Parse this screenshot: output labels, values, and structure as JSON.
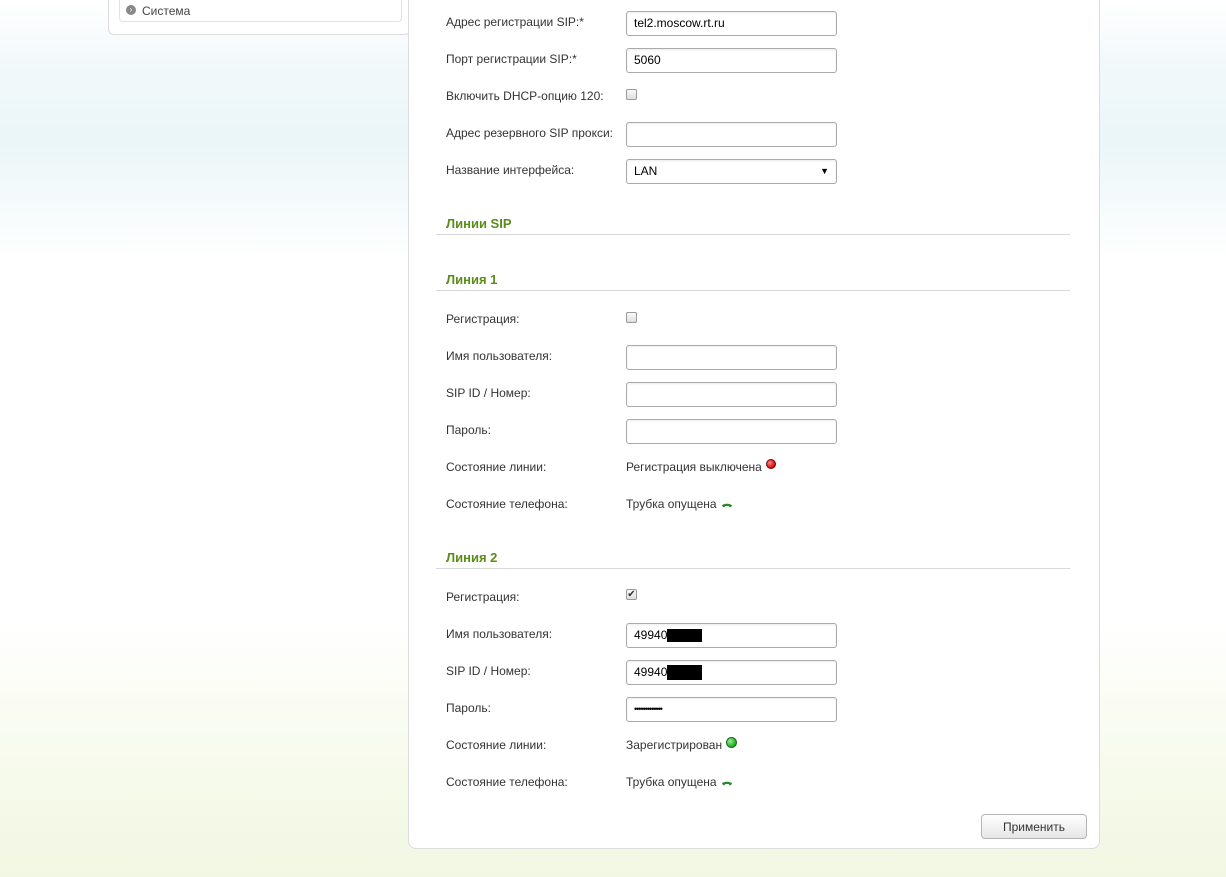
{
  "sidebar": {
    "item_label": "Система"
  },
  "sip": {
    "reg_addr_label": "Адрес регистрации SIP:*",
    "reg_addr_value": "tel2.moscow.rt.ru",
    "reg_port_label": "Порт регистрации SIP:*",
    "reg_port_value": "5060",
    "dhcp_label": "Включить DHCP-опцию 120:",
    "dhcp_checked": false,
    "backup_proxy_label": "Адрес резервного SIP прокси:",
    "backup_proxy_value": "",
    "iface_label": "Название интерфейса:",
    "iface_value": "LAN"
  },
  "lines_title": "Линии SIP",
  "line1": {
    "title": "Линия 1",
    "reg_label": "Регистрация:",
    "reg_checked": false,
    "user_label": "Имя пользователя:",
    "user_value": "",
    "sipid_label": "SIP ID / Номер:",
    "sipid_value": "",
    "pass_label": "Пароль:",
    "pass_value": "",
    "line_state_label": "Состояние линии:",
    "line_state_value": "Регистрация выключена",
    "line_state_color": "#dd2222",
    "phone_state_label": "Состояние телефона:",
    "phone_state_value": "Трубка опущена"
  },
  "line2": {
    "title": "Линия 2",
    "reg_label": "Регистрация:",
    "reg_checked": true,
    "user_label": "Имя пользователя:",
    "user_value": "49940",
    "sipid_label": "SIP ID / Номер:",
    "sipid_value": "49940",
    "pass_label": "Пароль:",
    "pass_value": "•••••••••••••",
    "line_state_label": "Состояние линии:",
    "line_state_value": "Зарегистрирован",
    "line_state_color": "#33bb33",
    "phone_state_label": "Состояние телефона:",
    "phone_state_value": "Трубка опущена"
  },
  "apply_button": "Применить",
  "colors": {
    "section_title": "#5b8c1a",
    "phone_icon": "#2a8a2a"
  }
}
